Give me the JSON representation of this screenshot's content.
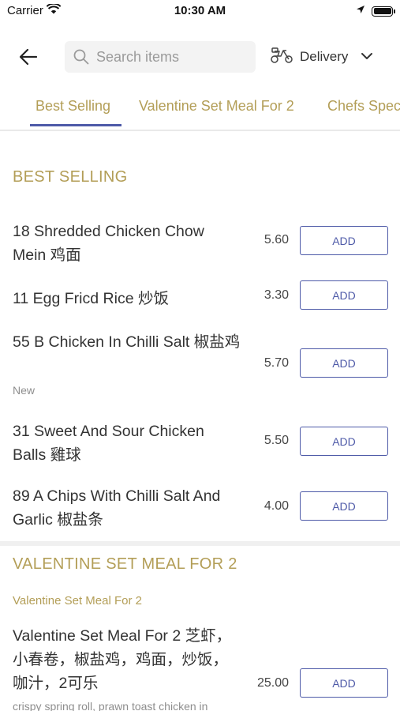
{
  "status_bar": {
    "carrier": "Carrier",
    "time": "10:30 AM"
  },
  "header": {
    "search_placeholder": "Search items",
    "delivery_label": "Delivery"
  },
  "tabs": [
    {
      "label": "Best Selling",
      "active": true
    },
    {
      "label": "Valentine Set Meal For 2",
      "active": false
    },
    {
      "label": "Chefs Speci",
      "active": false
    }
  ],
  "sections": [
    {
      "title": "BEST SELLING",
      "items": [
        {
          "name": "18 Shredded Chicken Chow Mein 鸡面",
          "price": "5.60",
          "button": "ADD"
        },
        {
          "name": "11 Egg Fricd Rice 炒饭",
          "price": "3.30",
          "button": "ADD"
        },
        {
          "name": "55 B Chicken In Chilli Salt 椒盐鸡",
          "tag": "New",
          "price": "5.70",
          "button": "ADD"
        },
        {
          "name": "31 Sweet And Sour Chicken Balls 雞球",
          "price": "5.50",
          "button": "ADD"
        },
        {
          "name": "89 A Chips With Chilli Salt And Garlic 椒盐条",
          "price": "4.00",
          "button": "ADD"
        }
      ]
    },
    {
      "title": "VALENTINE SET MEAL FOR 2",
      "subtitle": "Valentine Set Meal For 2",
      "items": [
        {
          "name": "Valentine Set Meal For 2 芝虾，小春卷，椒盐鸡，鸡面，炒饭，咖汁，2可乐",
          "price": "25.00",
          "button": "ADD",
          "description": "crispy spring roll, prawn toast chicken in"
        }
      ]
    }
  ]
}
